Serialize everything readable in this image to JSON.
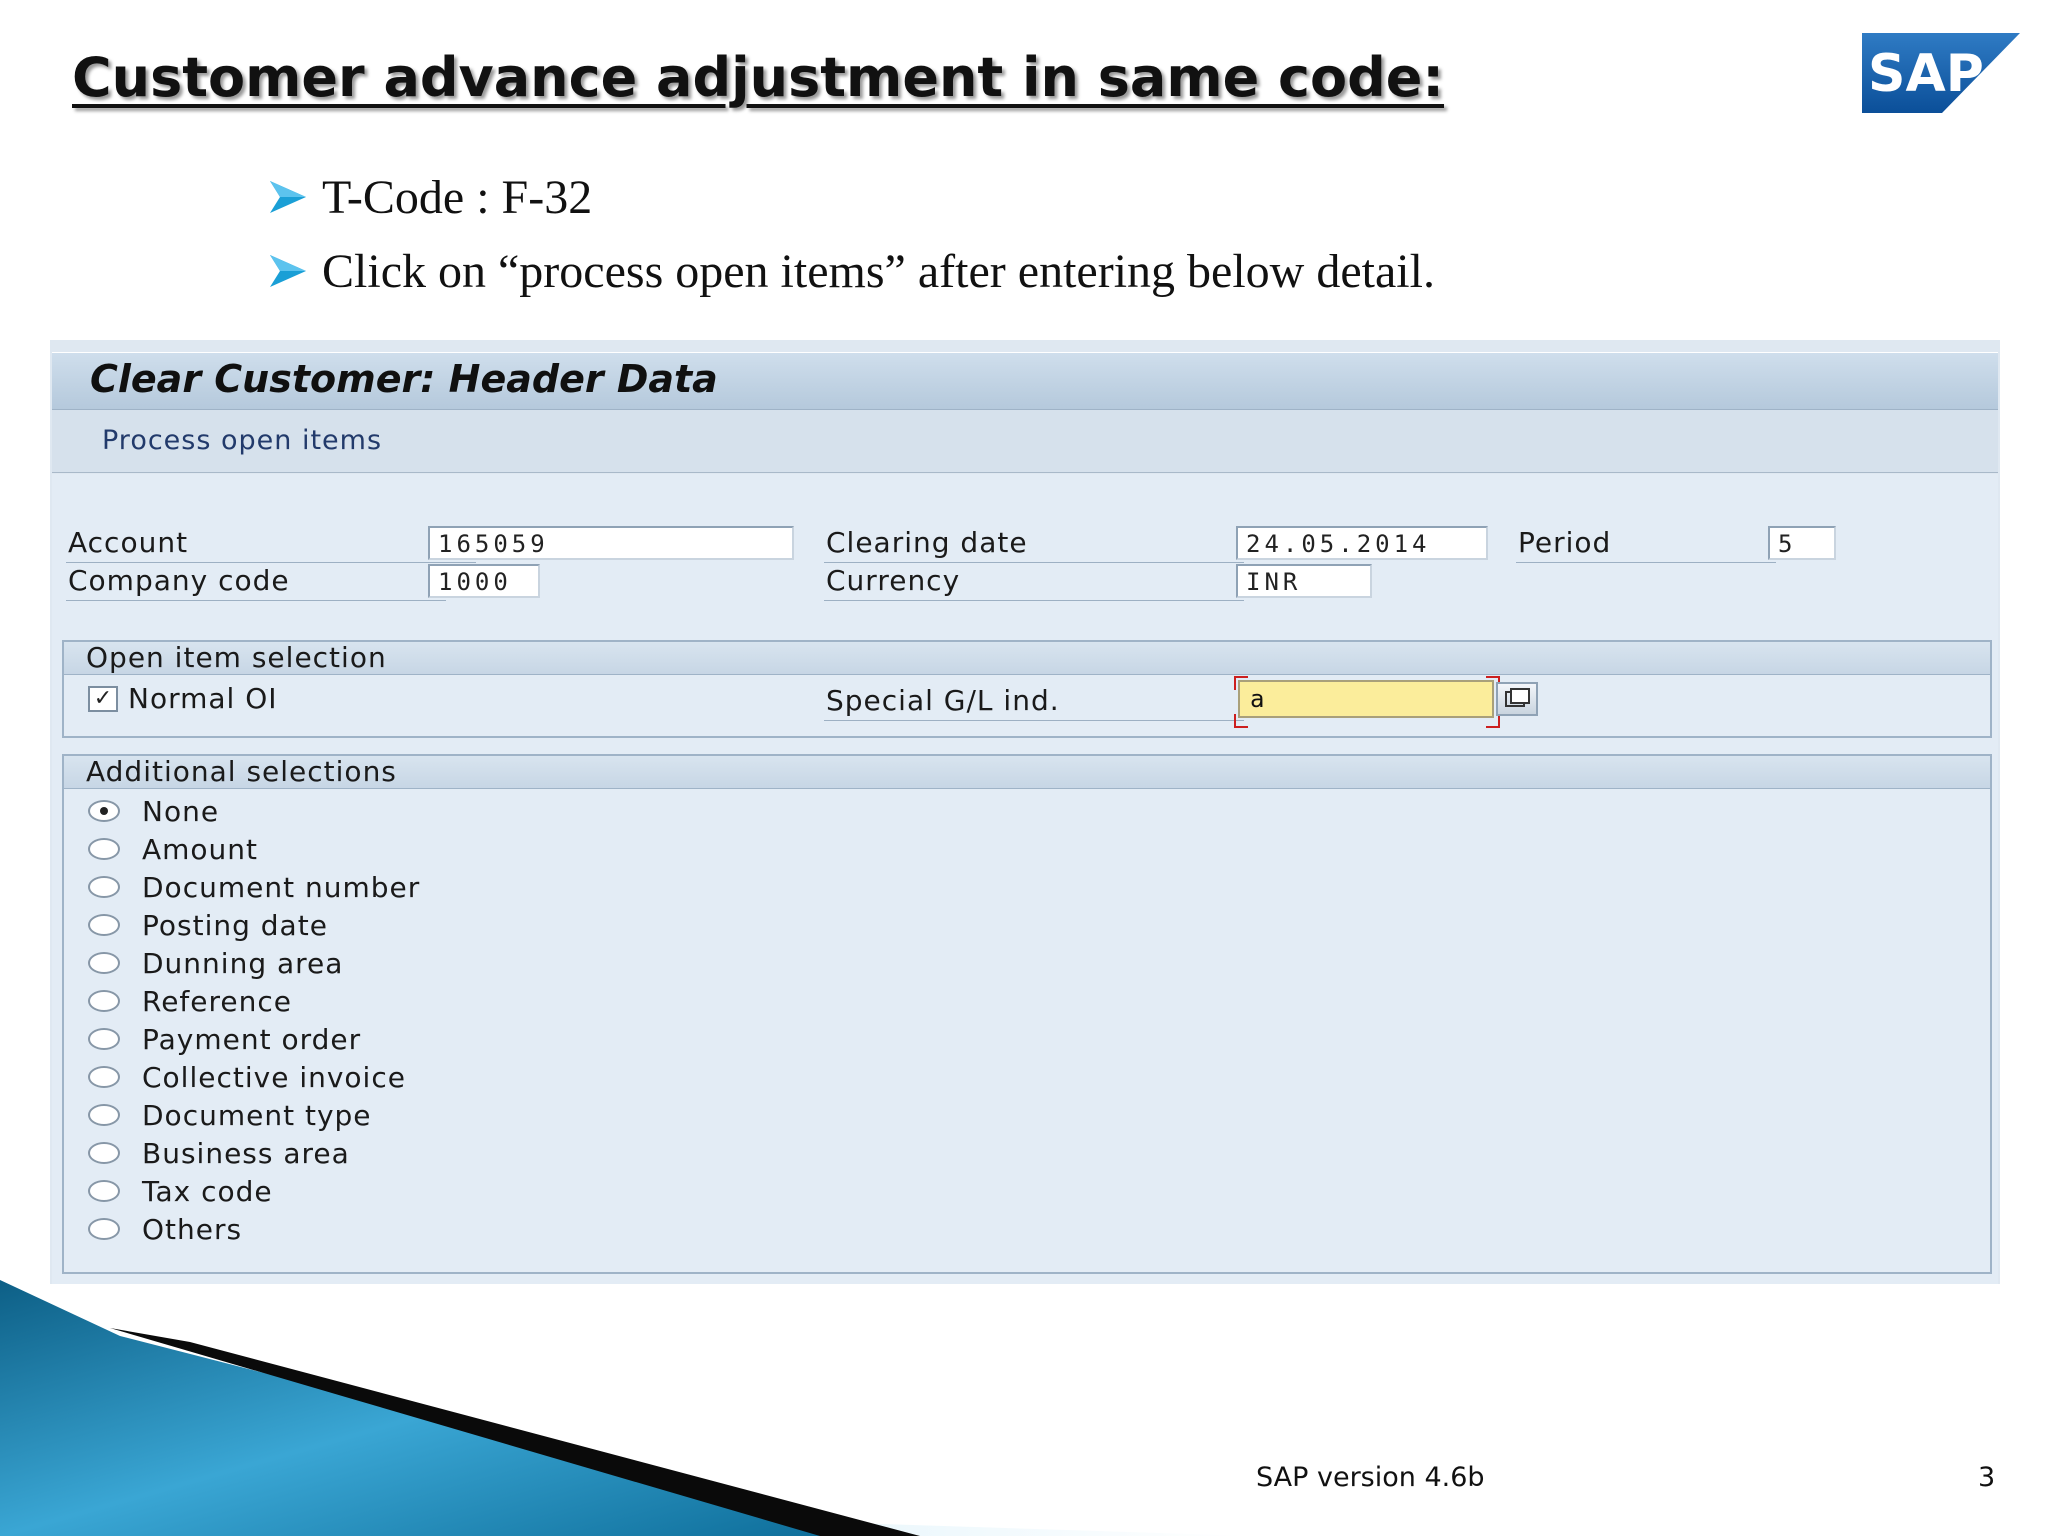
{
  "slide": {
    "title": "Customer advance adjustment in same code:",
    "logo_text": "SAP",
    "bullets": [
      "T-Code : F-32",
      "Click on “process open items”  after entering below detail."
    ],
    "footer": "SAP version 4.6b",
    "page_number": "3",
    "accent_color": "#1a9fd6"
  },
  "sap_screen": {
    "header_title": "Clear Customer: Header Data",
    "toolbar": {
      "process_open_items": "Process open items"
    },
    "fields": {
      "account": {
        "label": "Account",
        "value": "165059"
      },
      "company_code": {
        "label": "Company code",
        "value": "1000"
      },
      "clearing_date": {
        "label": "Clearing date",
        "value": "24.05.2014"
      },
      "period": {
        "label": "Period",
        "value": "5"
      },
      "currency": {
        "label": "Currency",
        "value": "INR"
      }
    },
    "open_item_selection": {
      "title": "Open item selection",
      "normal_oi": {
        "label": "Normal OI",
        "checked": true
      },
      "special_gl": {
        "label": "Special G/L ind.",
        "value": "a"
      }
    },
    "additional_selections": {
      "title": "Additional selections",
      "selected": "None",
      "options": [
        "None",
        "Amount",
        "Document number",
        "Posting date",
        "Dunning area",
        "Reference",
        "Payment order",
        "Collective invoice",
        "Document type",
        "Business area",
        "Tax code",
        "Others"
      ]
    }
  }
}
